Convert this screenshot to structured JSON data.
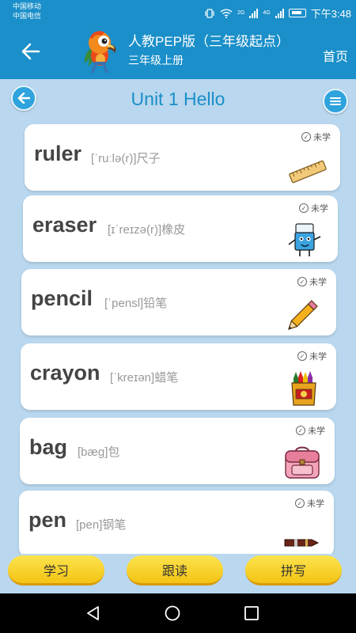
{
  "status_bar": {
    "carrier1": "中国移动",
    "carrier2": "中国电信",
    "net1": "2G",
    "net2": "4G",
    "time": "下午3:48"
  },
  "header": {
    "title": "人教PEP版（三年级起点）",
    "subtitle": "三年级上册",
    "home": "首页",
    "logo_icon": "parrot-icon"
  },
  "unit": {
    "title": "Unit 1 Hello"
  },
  "words": [
    {
      "word": "ruler",
      "phonetic": "[ˈruːlə(r)]尺子",
      "status": "未学",
      "image": "ruler-icon"
    },
    {
      "word": "eraser",
      "phonetic": "[ɪˈreɪzə(r)]橡皮",
      "status": "未学",
      "image": "eraser-icon"
    },
    {
      "word": "pencil",
      "phonetic": "[ˈpensl]铅笔",
      "status": "未学",
      "image": "pencil-icon"
    },
    {
      "word": "crayon",
      "phonetic": "[ˈkreɪən]蜡笔",
      "status": "未学",
      "image": "crayon-box-icon"
    },
    {
      "word": "bag",
      "phonetic": "[bæg]包",
      "status": "未学",
      "image": "schoolbag-icon"
    },
    {
      "word": "pen",
      "phonetic": "[pen]钢笔",
      "status": "未学",
      "image": "fountain-pen-icon"
    }
  ],
  "buttons": {
    "learn": "学习",
    "follow": "跟读",
    "spell": "拼写"
  },
  "colors": {
    "header": "#1a8fc9",
    "background": "#b9d7ee",
    "button": "#f3c414"
  }
}
